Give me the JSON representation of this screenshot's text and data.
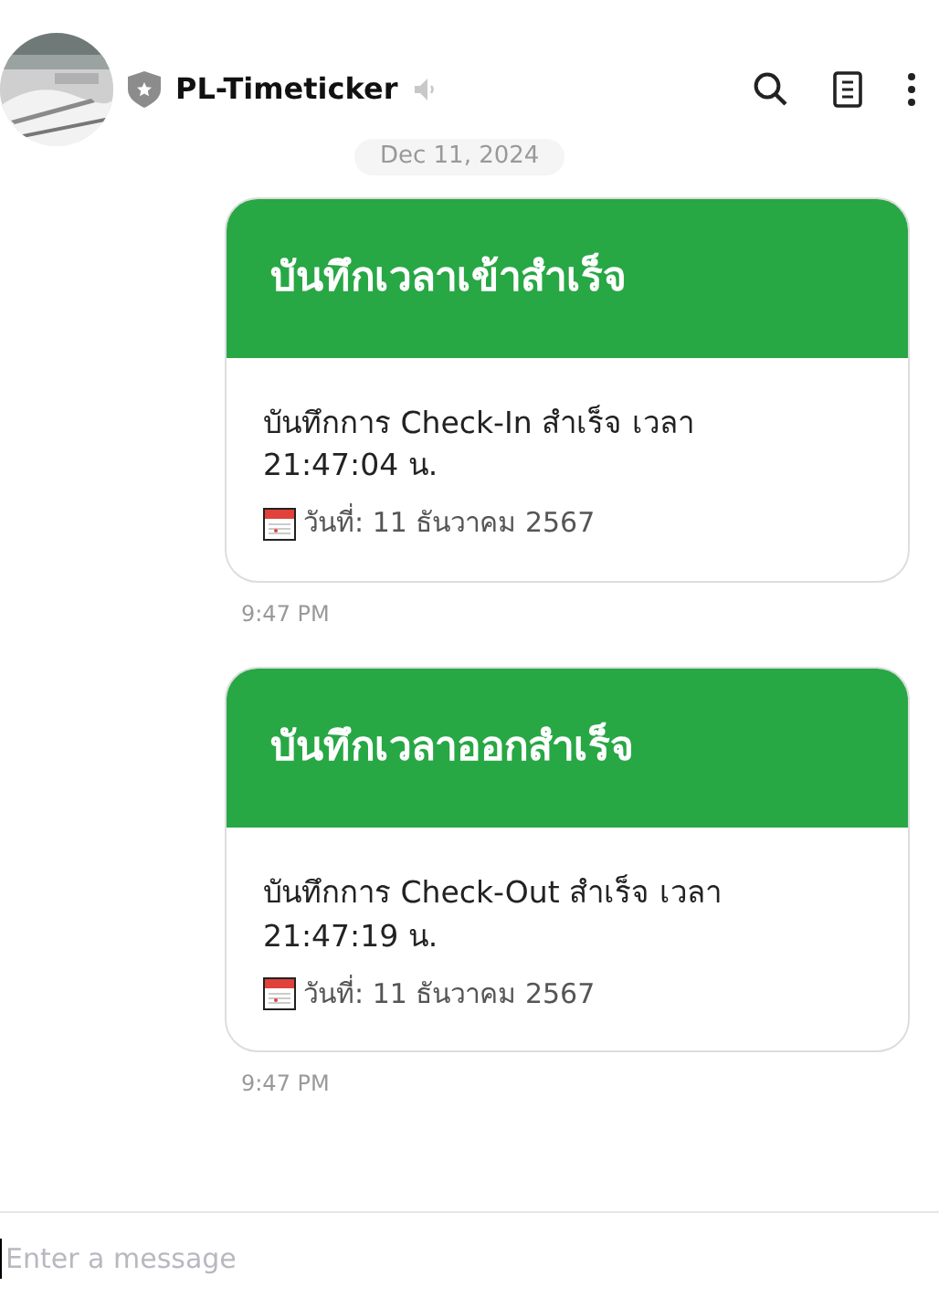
{
  "header": {
    "title": "PL-Timeticker",
    "verified": true,
    "muted": true
  },
  "date_separator": "Dec 11, 2024",
  "messages": [
    {
      "title": "บันทึกเวลาเข้าสำเร็จ",
      "body": "บันทึกการ Check-In สำเร็จ เวลา 21:47:04 น.",
      "date": "วันที่: 11 ธันวาคม 2567",
      "time": "9:47 PM"
    },
    {
      "title": "บันทึกเวลาออกสำเร็จ",
      "body": "บันทึกการ Check-Out สำเร็จ เวลา 21:47:19 น.",
      "date": "วันที่: 11 ธันวาคม 2567",
      "time": "9:47 PM"
    }
  ],
  "composer": {
    "placeholder": "Enter a message"
  }
}
